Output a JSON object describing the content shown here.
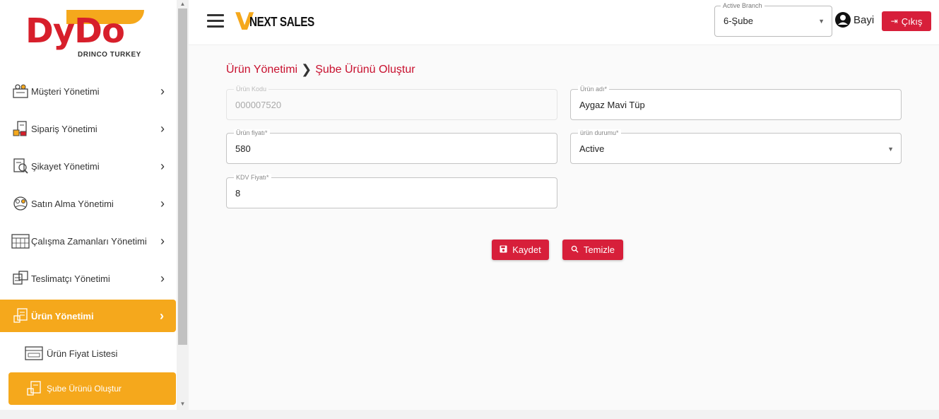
{
  "sidebar": {
    "logo": {
      "brand": "DyDo",
      "sub": "DRINCO TURKEY"
    },
    "items": [
      {
        "label": "Müşteri Yönetimi",
        "icon": "customers-icon"
      },
      {
        "label": "Sipariş Yönetimi",
        "icon": "order-icon"
      },
      {
        "label": "Şikayet Yönetimi",
        "icon": "complaint-icon"
      },
      {
        "label": "Satın Alma Yönetimi",
        "icon": "purchase-icon"
      },
      {
        "label": "Çalışma Zamanları Yönetimi",
        "icon": "calendar-icon"
      },
      {
        "label": "Teslimatçı Yönetimi",
        "icon": "delivery-icon"
      },
      {
        "label": "Ürün Yönetimi",
        "icon": "product-icon",
        "active": true
      }
    ],
    "subitems": [
      {
        "label": "Ürün Fiyat Listesi",
        "icon": "price-list-icon"
      },
      {
        "label": "Şube Ürünü Oluştur",
        "icon": "product-icon",
        "active": true
      }
    ]
  },
  "header": {
    "app_logo": {
      "mark": "V",
      "text": "NEXT SALES"
    },
    "branch": {
      "label": "Active Branch",
      "value": "6-Şube"
    },
    "user": "Bayi",
    "logout": "Çıkış"
  },
  "breadcrumb": {
    "parent": "Ürün Yönetimi",
    "separator": "❯",
    "current": "Şube Ürünü Oluştur"
  },
  "form": {
    "product_code": {
      "label": "Ürün Kodu",
      "value": "000007520"
    },
    "product_name": {
      "label": "Ürün adı*",
      "value": "Aygaz Mavi Tüp"
    },
    "product_price": {
      "label": "Ürün fiyatı*",
      "value": "580"
    },
    "product_status": {
      "label": "ürün durumu*",
      "value": "Active"
    },
    "kdv_price": {
      "label": "KDV Fiyatı*",
      "value": "8"
    }
  },
  "actions": {
    "save": "Kaydet",
    "clear": "Temizle"
  },
  "colors": {
    "accent": "#f5a81c",
    "primary": "#d71f3a",
    "breadcrumb": "#c8102e"
  }
}
